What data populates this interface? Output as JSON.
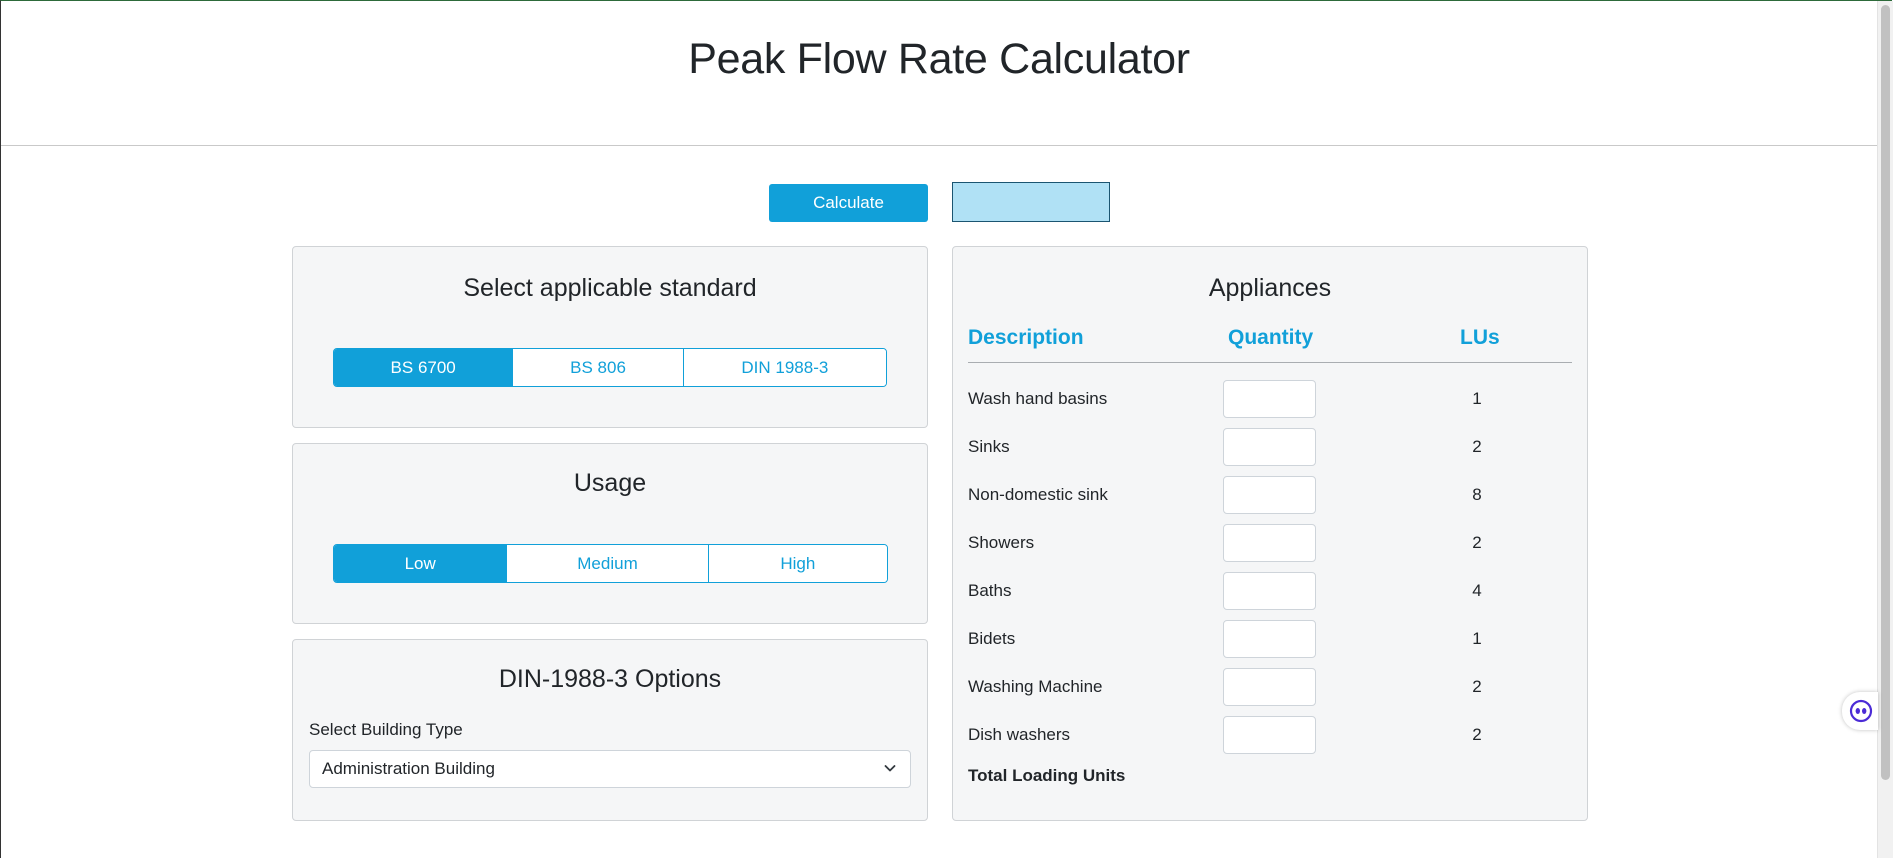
{
  "header": {
    "title": "Peak Flow Rate Calculator"
  },
  "toolbar": {
    "calculate_label": "Calculate",
    "result_value": ""
  },
  "standard": {
    "title": "Select applicable standard",
    "options": [
      "BS 6700",
      "BS 806",
      "DIN 1988-3"
    ],
    "selected": "BS 6700"
  },
  "usage": {
    "title": "Usage",
    "options": [
      "Low",
      "Medium",
      "High"
    ],
    "selected": "Low"
  },
  "din": {
    "title": "DIN-1988-3 Options",
    "select_label": "Select Building Type",
    "select_value": "Administration Building"
  },
  "appliances": {
    "title": "Appliances",
    "columns": [
      "Description",
      "Quantity",
      "LUs"
    ],
    "rows": [
      {
        "description": "Wash hand basins",
        "quantity": "",
        "lus": "1"
      },
      {
        "description": "Sinks",
        "quantity": "",
        "lus": "2"
      },
      {
        "description": "Non-domestic sink",
        "quantity": "",
        "lus": "8"
      },
      {
        "description": "Showers",
        "quantity": "",
        "lus": "2"
      },
      {
        "description": "Baths",
        "quantity": "",
        "lus": "4"
      },
      {
        "description": "Bidets",
        "quantity": "",
        "lus": "1"
      },
      {
        "description": "Washing Machine",
        "quantity": "",
        "lus": "2"
      },
      {
        "description": "Dish washers",
        "quantity": "",
        "lus": "2"
      }
    ],
    "total_label": "Total Loading Units"
  },
  "icons": {
    "chevron": "chevron-down-icon",
    "assistant": "assistant-widget-icon"
  },
  "colors": {
    "accent": "#11a0d9",
    "result_box": "#b0e1f5"
  }
}
